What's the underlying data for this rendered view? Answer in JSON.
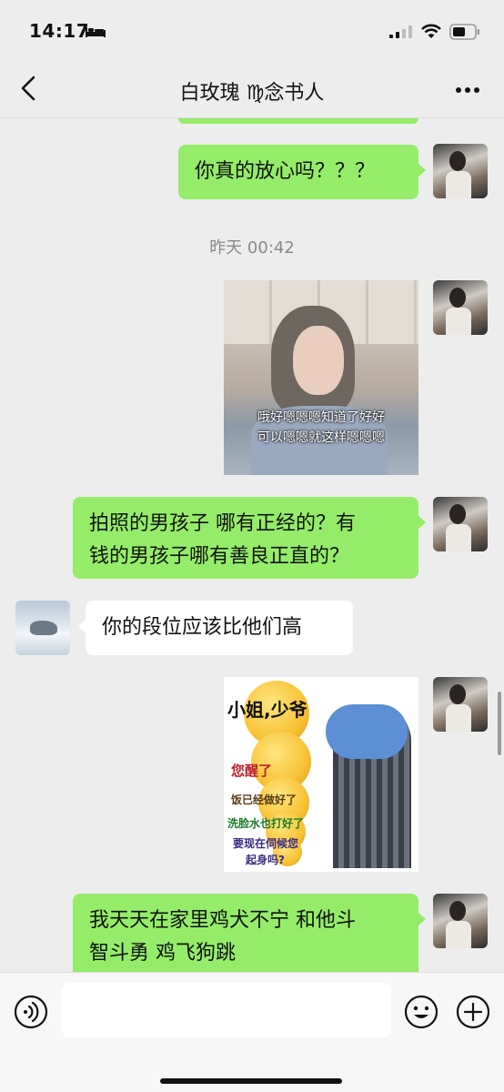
{
  "status_bar": {
    "time": "14:17",
    "icons": [
      "bed-icon",
      "signal-icon",
      "wifi-icon",
      "battery-icon"
    ]
  },
  "nav": {
    "back_icon": "chevron-left-icon",
    "title": "白玫瑰 ♍念书人",
    "more_icon": "more-dots-icon"
  },
  "messages": {
    "m1_text": "你真的放心吗？？？",
    "timestamp": "昨天 00:42",
    "m2_caption_line1": "哦好嗯嗯嗯知道了好好",
    "m2_caption_line2": "可以嗯嗯就这样嗯嗯嗯",
    "m3_line1": "拍照的男孩子 哪有正经的？有",
    "m3_line2": "钱的男孩子哪有善良正直的？",
    "m4_text": "你的段位应该比他们高",
    "m5_sticker_lines": [
      "小姐,少爷",
      "您醒了",
      "饭已经做好了",
      "洗脸水也打好了",
      "要现在伺候您",
      "起身吗?"
    ],
    "m6_line1": "我天天在家里鸡犬不宁 和他斗",
    "m6_line2": "智斗勇 鸡飞狗跳"
  },
  "input_bar": {
    "placeholder": "",
    "icons": [
      "voice-icon",
      "emoji-icon",
      "plus-icon"
    ]
  },
  "colors": {
    "self_bubble": "#95ec69",
    "other_bubble": "#ffffff",
    "background": "#ededed"
  }
}
